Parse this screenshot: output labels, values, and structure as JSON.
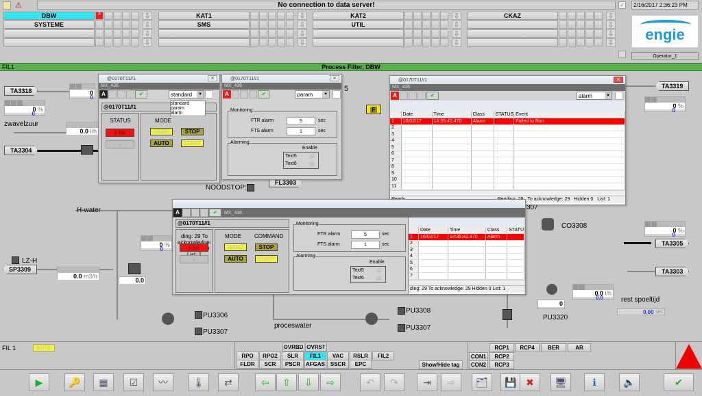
{
  "header": {
    "message": "No connection to data server!",
    "datetime": "2/16/2017 2:36:23 PM",
    "operator": "Operator_1",
    "logo": "engie",
    "brand_color": "#1e9bd7"
  },
  "nav": {
    "rows": [
      [
        "DBW",
        "KAT1",
        "KAT2",
        "CKAZ"
      ],
      [
        "SYSTEME",
        "SMS",
        "UTIL",
        ""
      ],
      [
        "",
        "",
        "",
        ""
      ],
      [
        "",
        "",
        "",
        ""
      ]
    ],
    "alarm_badge": "A",
    "active": "DBW"
  },
  "greenbar": {
    "left": "FIL1",
    "title": "Process Filter, DBW"
  },
  "tags": {
    "TA3318": "TA3318",
    "TA3304": "TA3304",
    "TA3319": "TA3319",
    "TA3305": "TA3305",
    "TA3303": "TA3303",
    "SP3309": "SP3309",
    "FL3303": "FL3303"
  },
  "labels": {
    "zwavelzuur": "zwavelzuur",
    "hwater": "H-water",
    "lzh": "LZ-H",
    "noodstop": "NOODSTOP:",
    "pu3306": "PU3306",
    "pu3307a": "PU3307",
    "pu3308": "PU3308",
    "pu3307b": "PU3307",
    "proceswater": "proceswater",
    "co3308": "CO3308",
    "pu3320": "PU3320",
    "rest": "rest spoeltijd",
    "partial307": "307",
    "partial5": "5",
    "f_badge": "F"
  },
  "gauges": {
    "g1": {
      "v": "0",
      "v2": "0"
    },
    "g2": {
      "v": "0",
      "unit": "%",
      "v2": "0"
    },
    "g3": {
      "v": "0.0",
      "unit": "l/h"
    },
    "g4": {
      "v": "0",
      "unit": "%",
      "v2": "0"
    },
    "g5": {
      "v": "0.0",
      "unit": "m3/h"
    },
    "g6": {
      "v": "0.0"
    },
    "g7": {
      "v": "0",
      "unit": "%",
      "v2": "0"
    },
    "g8": {
      "v": "0",
      "unit": "%",
      "v2": "0"
    },
    "g9": {
      "v": "0.0",
      "unit": "l/h",
      "v2": "0.0"
    },
    "g10": {
      "v": "0",
      "unit": "%"
    },
    "g11": {
      "v": "0.00",
      "unit": "sec"
    }
  },
  "win1": {
    "title": "@0170T11//1",
    "sub": "MX_436",
    "badge": "A",
    "select": "standard",
    "options": [
      "standard",
      "param",
      "alarm"
    ],
    "header": "@0170T11//1",
    "status": "STATUS",
    "mode": "MODE",
    "ftr": "FTR",
    "dash": "-",
    "hand": "HAND",
    "stop": "STOP",
    "auto": "AUTO",
    "start": "START"
  },
  "win2": {
    "title": "@0170T11//1",
    "sub": "MX_436",
    "badge": "A",
    "select": "param",
    "monitoring": "Monitoring",
    "ftr_alarm": "FTR alarm",
    "ftr_val": "5",
    "fts_alarm": "FTS alarm",
    "fts_val": "1",
    "sec": "sec",
    "alarming": "Alarming",
    "enable": "Enable",
    "text5": "Text5",
    "text6": "Text6"
  },
  "win3": {
    "title": "@0170T11//1",
    "sub": "MX_436",
    "badge": "A",
    "select": "alarm",
    "columns": [
      "",
      "Date",
      "Time",
      "Class",
      "STATUS",
      "Event"
    ],
    "rows": [
      [
        "1",
        "16/02/17",
        "14:35:42.470",
        "Alarm",
        "",
        "Failed to Run"
      ],
      [
        "2",
        "",
        "",
        "",
        "",
        ""
      ],
      [
        "3",
        "",
        "",
        "",
        "",
        ""
      ],
      [
        "4",
        "",
        "",
        "",
        "",
        ""
      ],
      [
        "5",
        "",
        "",
        "",
        "",
        ""
      ],
      [
        "6",
        "",
        "",
        "",
        "",
        ""
      ],
      [
        "7",
        "",
        "",
        "",
        "",
        ""
      ],
      [
        "8",
        "",
        "",
        "",
        "",
        ""
      ],
      [
        "9",
        "",
        "",
        "",
        "",
        ""
      ],
      [
        "10",
        "",
        "",
        "",
        "",
        ""
      ],
      [
        "11",
        "",
        "",
        "",
        "",
        ""
      ]
    ],
    "status_left": "Ready",
    "pending": "Pending: 29",
    "to_ack": "To acknowledge: 29",
    "hidden": "Hidden 0",
    "list": "List: 1"
  },
  "win4": {
    "sub": "MX_436",
    "badge": "A",
    "header": "@0170T11//1",
    "status": "ding: 29  To acknowledge: 29  Hidden 0  List: 1",
    "mode": "MODE",
    "command": "COMMAND",
    "ftr": "FTR",
    "dash": "-",
    "hand": "HAND",
    "stop": "STOP",
    "auto": "AUTO",
    "start": "START",
    "monitoring": "Monitoring",
    "ftr_alarm": "FTR alarm",
    "ftr_val": "5",
    "fts_alarm": "FTS alarm",
    "fts_val": "1",
    "sec": "sec",
    "alarming": "Alarming",
    "enable": "Enable",
    "text5": "Text5",
    "text6": "Text6",
    "columns": [
      "",
      "Date",
      "Time",
      "Class",
      "STATU"
    ],
    "rows": [
      [
        "1",
        "16/02/17",
        "14:35:42.470",
        "Alarm",
        ""
      ],
      [
        "2",
        "",
        "",
        "",
        ""
      ],
      [
        "3",
        "",
        "",
        "",
        ""
      ],
      [
        "4",
        "",
        "",
        "",
        ""
      ],
      [
        "5",
        "",
        "",
        "",
        ""
      ],
      [
        "6",
        "",
        "",
        "",
        ""
      ],
      [
        "7",
        "",
        "",
        "",
        ""
      ]
    ]
  },
  "footer": {
    "area": "FIL 1",
    "mode": "AUTO",
    "row0": [
      "OVRBD",
      "OVRST"
    ],
    "row1": [
      "RPO",
      "RPO2",
      "SLR",
      "FIL1",
      "VAC",
      "RSLR",
      "FIL2"
    ],
    "row2": [
      "FLDR",
      "SCR",
      "PSCR",
      "AFGAS",
      "SSCR",
      "EPC"
    ],
    "active": "FIL1",
    "showhide": "Show/Hide tag",
    "con": [
      "CON1",
      "CON2"
    ],
    "rcp": [
      "RCP1",
      "RCP2",
      "RCP3",
      "RCP4",
      "BER",
      "AR"
    ]
  },
  "toolbar": {
    "icons": [
      "play-icon",
      "key-icon",
      "new-table-icon",
      "checklist-icon",
      "trend-icon",
      "thermometer-icon",
      "transfer-icon",
      "arrow-left-icon",
      "arrow-up-icon",
      "arrow-down-icon",
      "arrow-right-icon",
      "undo-icon",
      "redo-icon",
      "enter-screen-icon",
      "exit-screen-icon",
      "open-windows-icon",
      "save-windows-icon",
      "close-windows-icon",
      "monitor-view-icon",
      "info-icon",
      "silence-alarm-icon",
      "acknowledge-all-icon"
    ]
  }
}
